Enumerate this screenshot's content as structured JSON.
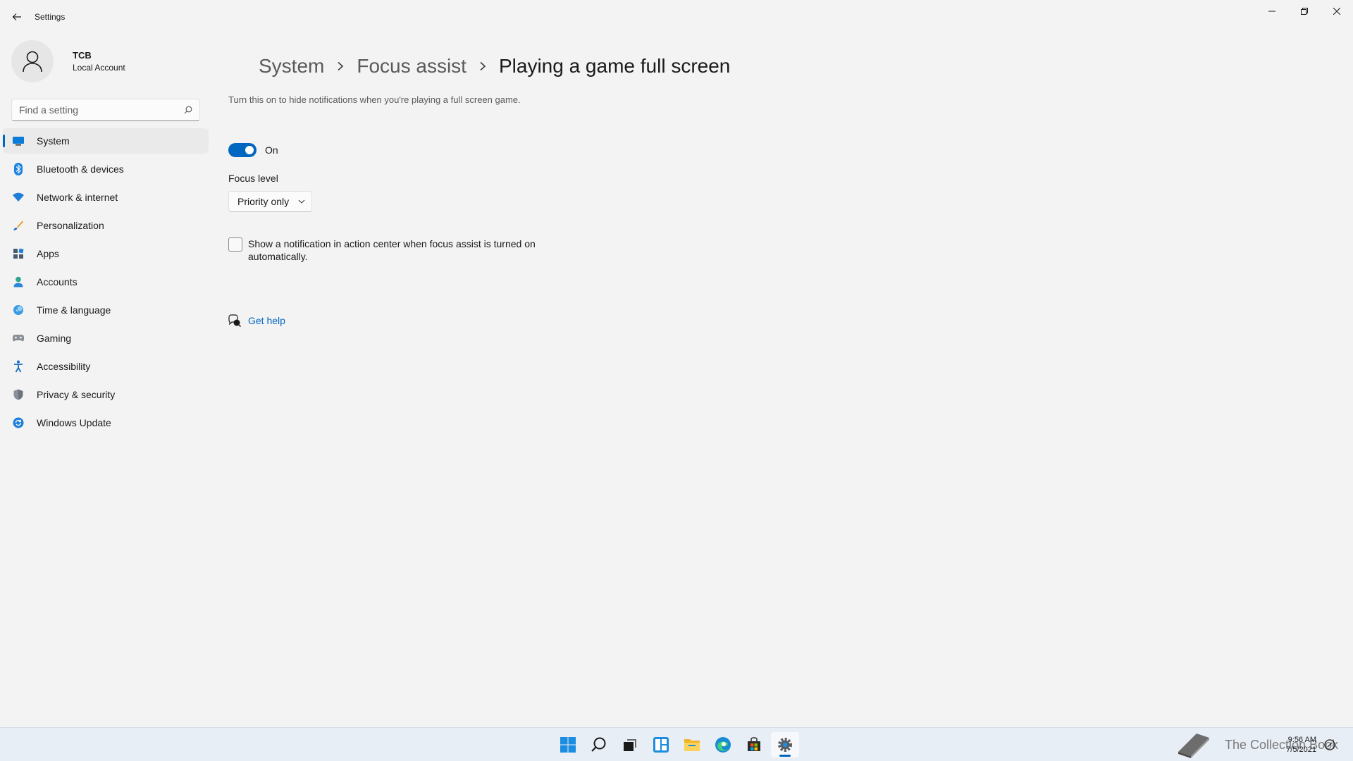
{
  "window": {
    "title": "Settings"
  },
  "user": {
    "name": "TCB",
    "account_type": "Local Account"
  },
  "search": {
    "placeholder": "Find a setting"
  },
  "sidebar": {
    "items": [
      {
        "label": "System",
        "icon": "system-icon",
        "active": true
      },
      {
        "label": "Bluetooth & devices",
        "icon": "bluetooth-icon"
      },
      {
        "label": "Network & internet",
        "icon": "network-icon"
      },
      {
        "label": "Personalization",
        "icon": "brush-icon"
      },
      {
        "label": "Apps",
        "icon": "apps-icon"
      },
      {
        "label": "Accounts",
        "icon": "accounts-icon"
      },
      {
        "label": "Time & language",
        "icon": "time-language-icon"
      },
      {
        "label": "Gaming",
        "icon": "gaming-icon"
      },
      {
        "label": "Accessibility",
        "icon": "accessibility-icon"
      },
      {
        "label": "Privacy & security",
        "icon": "shield-icon"
      },
      {
        "label": "Windows Update",
        "icon": "update-icon"
      }
    ]
  },
  "breadcrumb": {
    "items": [
      "System",
      "Focus assist"
    ],
    "current": "Playing a game full screen"
  },
  "main": {
    "description": "Turn this on to hide notifications when you're playing a full screen game.",
    "toggle_state": "On",
    "focus_level_label": "Focus level",
    "focus_level_value": "Priority only",
    "checkbox_label": "Show a notification in action center when focus assist is turned on automatically.",
    "help_link": "Get help"
  },
  "taskbar": {
    "apps": [
      "start-icon",
      "search-icon",
      "task-view-icon",
      "widgets-icon",
      "file-explorer-icon",
      "edge-icon",
      "store-icon",
      "settings-icon"
    ],
    "time": "9:56 AM",
    "date": "7/5/2021",
    "watermark": "The Collection Book"
  },
  "colors": {
    "accent": "#0067c0",
    "background": "#f3f3f3"
  }
}
